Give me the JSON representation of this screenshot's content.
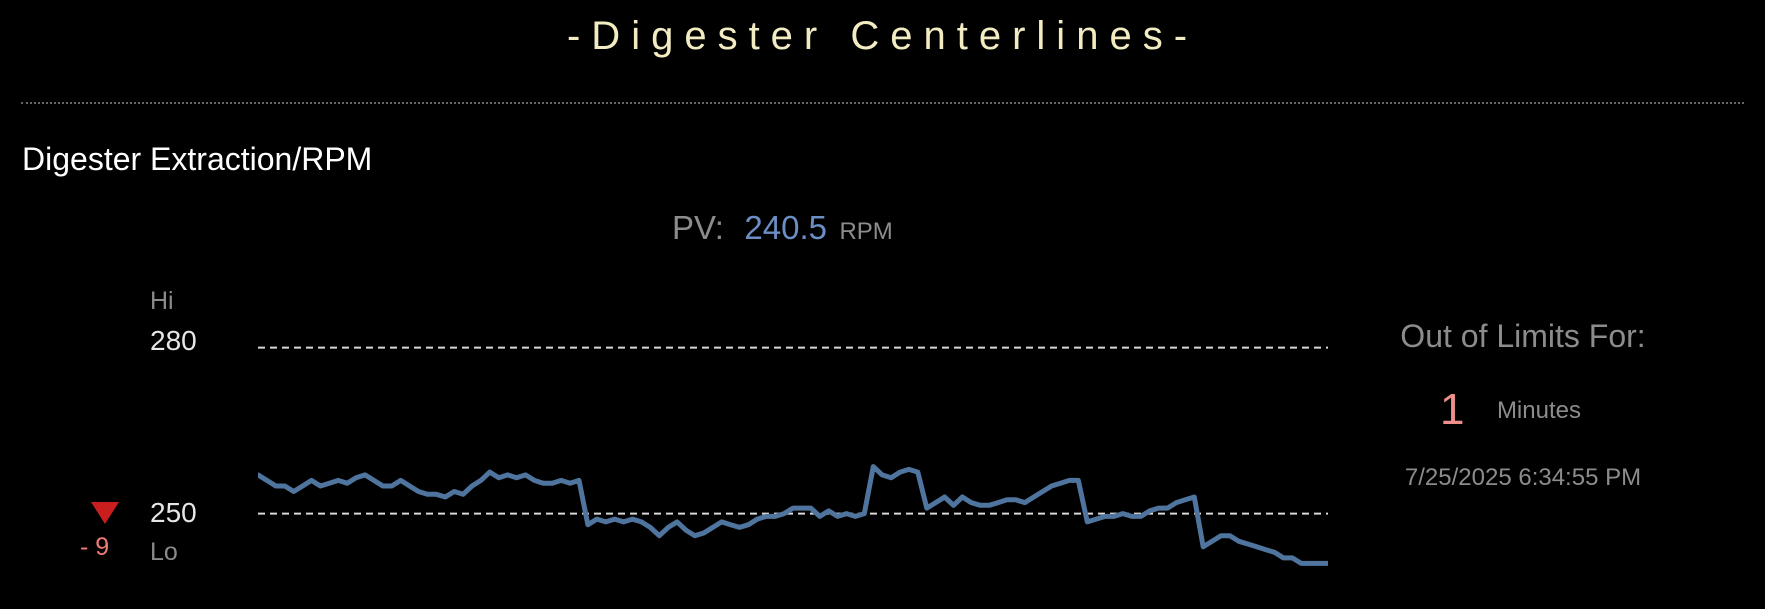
{
  "header": {
    "title": "-Digester Centerlines-"
  },
  "section": {
    "title": "Digester Extraction/RPM"
  },
  "pv": {
    "label": "PV:",
    "value": "240.5",
    "unit": "RPM"
  },
  "limits": {
    "hi_label": "Hi",
    "hi_value": "280",
    "lo_value": "250",
    "lo_label": "Lo",
    "deviation": "- 9",
    "deviation_color": "#ef7b78",
    "alarm_icon": "down-triangle-icon",
    "alarm_color": "#c81e1e"
  },
  "out_of_limits": {
    "label": "Out of Limits For:",
    "count": "1",
    "unit": "Minutes",
    "timestamp": "7/25/2025 6:34:55 PM"
  },
  "chart_data": {
    "type": "line",
    "ylim": [
      238,
      285
    ],
    "hi_limit": 280,
    "lo_limit": 250,
    "grid": false,
    "series": [
      {
        "color": "#4f749e",
        "values": [
          257,
          256,
          255,
          255,
          254,
          255,
          256,
          255,
          255.5,
          256,
          255.5,
          256.5,
          257,
          256,
          255,
          255,
          256,
          255,
          254,
          253.5,
          253.5,
          253,
          254,
          253.5,
          255,
          256,
          257.5,
          256.5,
          257,
          256.5,
          257,
          256,
          255.5,
          255.5,
          256,
          255.5,
          256,
          248,
          249,
          248.5,
          249,
          248.5,
          249,
          248.5,
          247.5,
          246,
          247.5,
          248.5,
          247,
          246,
          246.5,
          247.5,
          248.5,
          248,
          247.5,
          248,
          249,
          249.5,
          249.5,
          250,
          251,
          251,
          251,
          249.5,
          250.5,
          249.5,
          250,
          249.5,
          250,
          258.5,
          257,
          256.5,
          257.5,
          258,
          257.5,
          251,
          252,
          253,
          251.5,
          253,
          252,
          251.5,
          251.5,
          252,
          252.5,
          252.5,
          252,
          253,
          254,
          255,
          255.5,
          256,
          256,
          248.5,
          249,
          249.5,
          249.5,
          250,
          249.5,
          249.5,
          250.5,
          251,
          251,
          252,
          252.5,
          253,
          244,
          245,
          246,
          246,
          245,
          244.5,
          244,
          243.5,
          243,
          242,
          242,
          241,
          241,
          241,
          241
        ]
      }
    ]
  }
}
